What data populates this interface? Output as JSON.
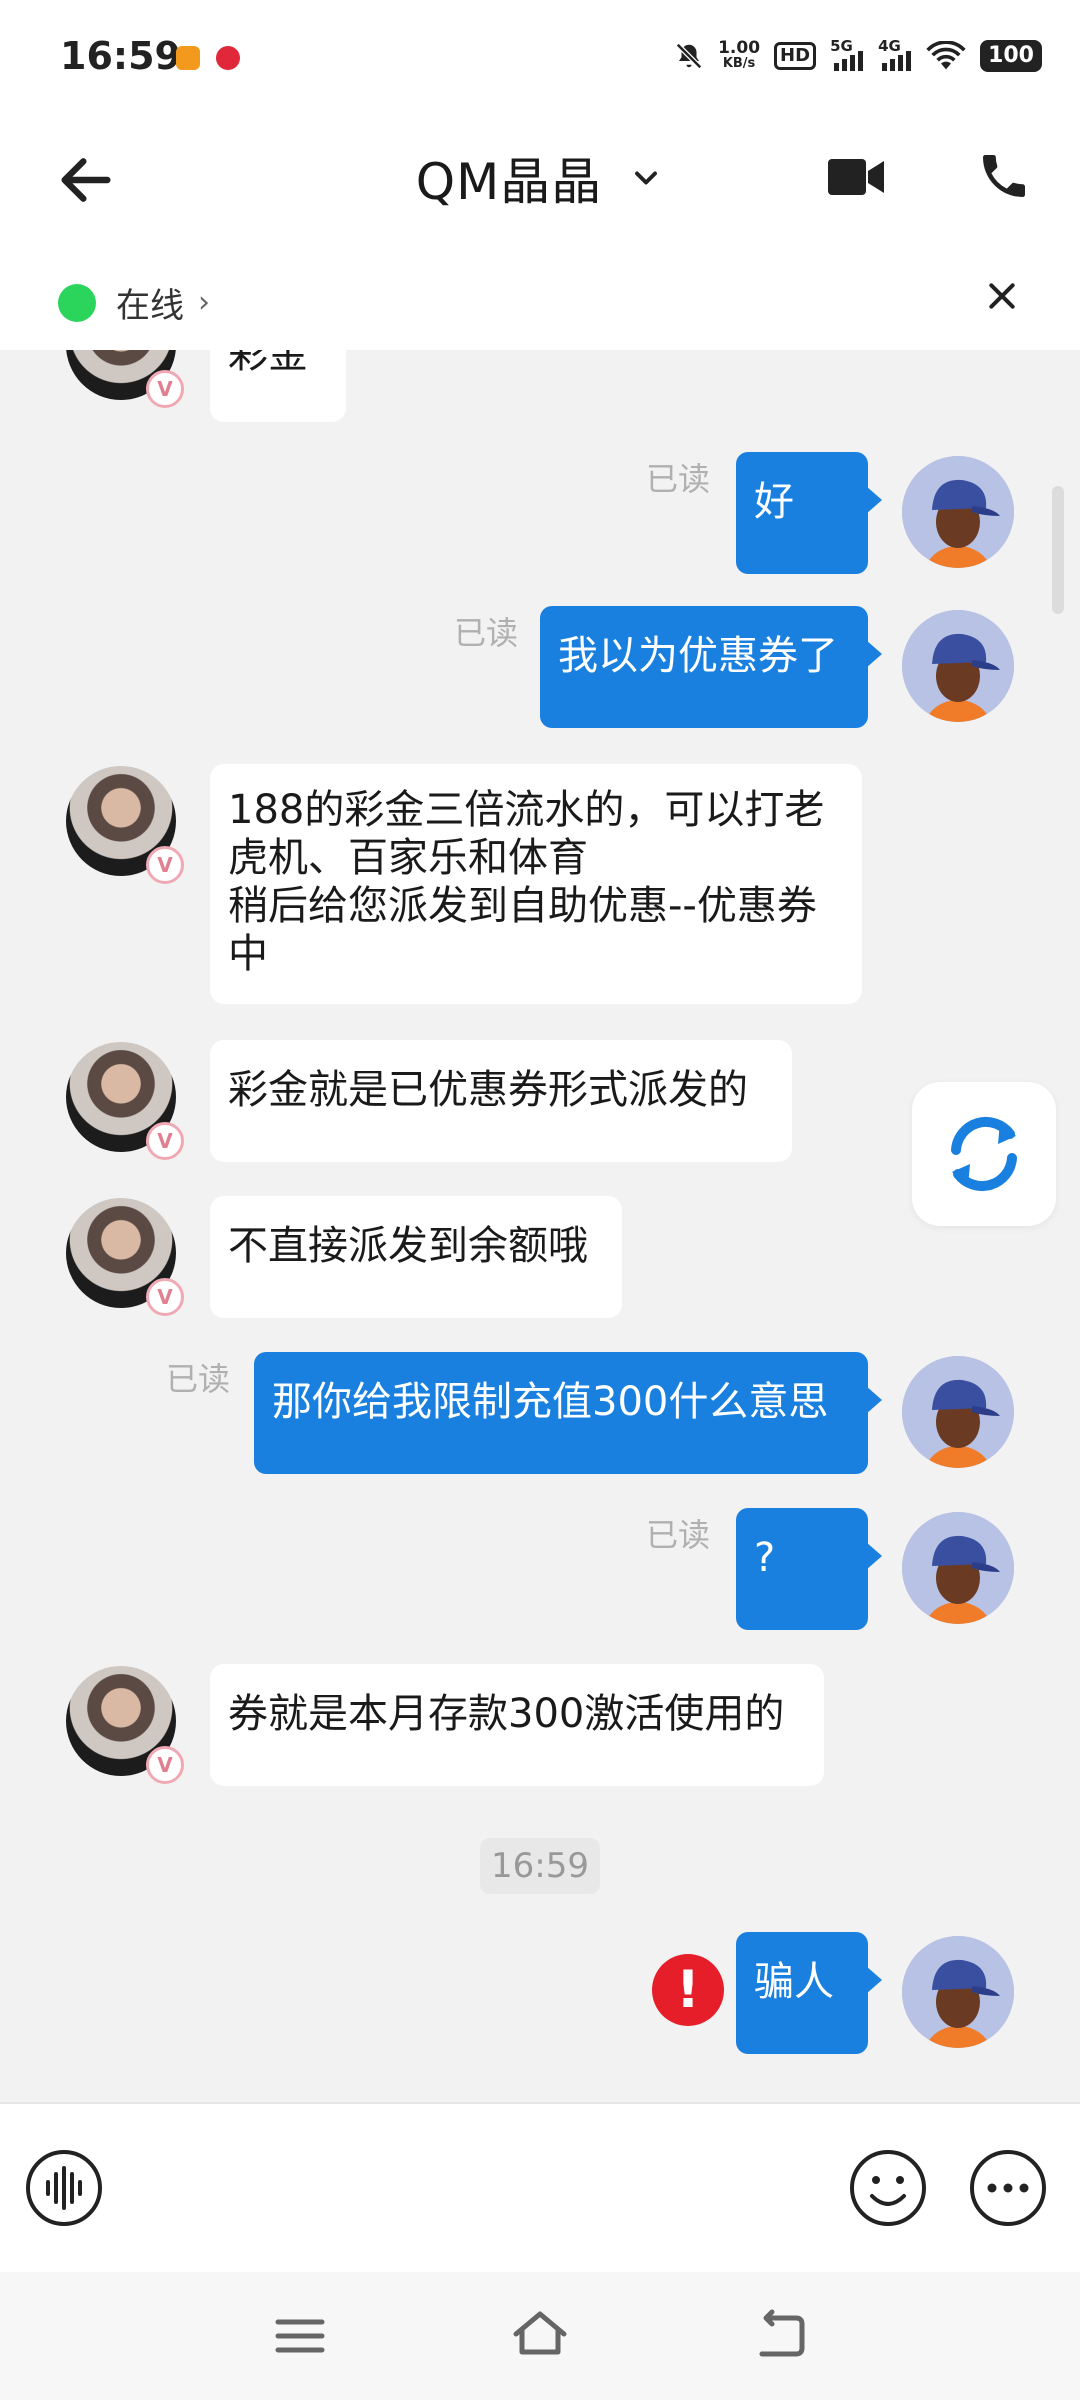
{
  "status_bar": {
    "time": "16:59",
    "speed_value": "1.00",
    "speed_unit": "KB/s",
    "hd_label": "HD",
    "sig1_label": "5G",
    "sig2_label": "4G",
    "battery": "100"
  },
  "header": {
    "title": "QM晶晶",
    "status_label": "在线",
    "status_chevron": "›"
  },
  "messages": [
    {
      "side": "in",
      "text": "彩金"
    },
    {
      "side": "out",
      "text": "好",
      "read": "已读"
    },
    {
      "side": "out",
      "text": "我以为优惠券了",
      "read": "已读"
    },
    {
      "side": "in",
      "text": "188的彩金三倍流水的，可以打老虎机、百家乐和体育\n稍后给您派发到自助优惠--优惠券中"
    },
    {
      "side": "in",
      "text": "彩金就是已优惠券形式派发的"
    },
    {
      "side": "in",
      "text": "不直接派发到余额哦"
    },
    {
      "side": "out",
      "text": "那你给我限制充值300什么意思",
      "read": "已读"
    },
    {
      "side": "out",
      "text": "?",
      "read": "已读"
    },
    {
      "side": "in",
      "text": "券就是本月存款300激活使用的"
    },
    {
      "side": "out",
      "text": "骗人",
      "failed": true
    }
  ],
  "time_divider": "16:59",
  "error_mark": "!",
  "badge_letter": "V",
  "icons": {
    "back": "back-arrow-icon",
    "video": "video-call-icon",
    "phone": "phone-icon",
    "close": "close-icon",
    "refresh": "refresh-icon",
    "voice": "voice-icon",
    "emoji": "emoji-icon",
    "more": "more-icon"
  },
  "colors": {
    "outgoing_bubble": "#1a80e0",
    "online_dot": "#2bd45a",
    "error": "#e61e2a"
  }
}
